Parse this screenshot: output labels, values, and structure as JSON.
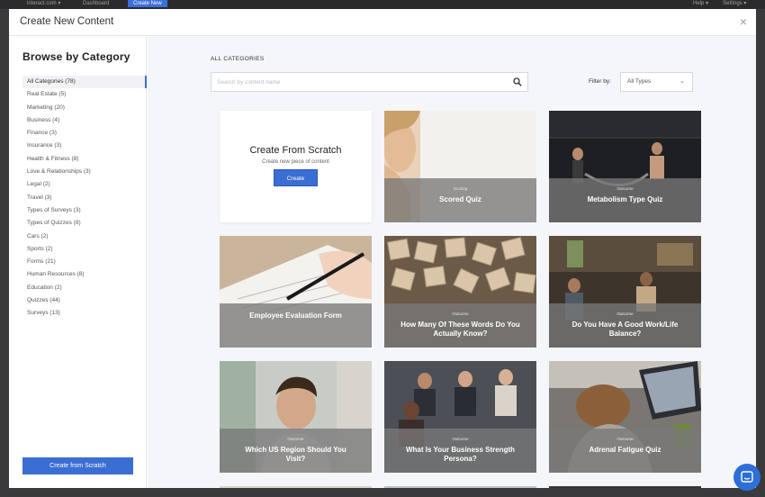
{
  "app_bar": {
    "items": [
      "interact.com ▾",
      "Dashboard",
      "Create New"
    ],
    "right_items": [
      "Help ▾",
      "Settings ▾"
    ]
  },
  "modal": {
    "title": "Create New Content",
    "close_label": "×"
  },
  "sidebar": {
    "title": "Browse by Category",
    "categories": [
      "All Categories (78)",
      "Real Estate (5)",
      "Marketing (20)",
      "Business (4)",
      "Finance (3)",
      "Insurance (3)",
      "Health & Fitness (8)",
      "Love & Relationships (3)",
      "Legal (2)",
      "Travel (3)",
      "Types of Surveys (3)",
      "Types of Quizzes (8)",
      "Cars (2)",
      "Sports (2)",
      "Forms (21)",
      "Human Resources (8)",
      "Education (2)",
      "Quizzes (44)",
      "Surveys (13)"
    ],
    "scratch_button": "Create from Scratch"
  },
  "main": {
    "section_label": "ALL CATEGORIES",
    "search_placeholder": "Search by content name",
    "filter_label": "Filter by:",
    "filter_value": "All Types",
    "scratch_card": {
      "title": "Create From Scratch",
      "subtitle": "Create new piece of content",
      "button": "Create"
    },
    "cards": [
      {
        "badge": "Scoring",
        "title": "Scored Quiz"
      },
      {
        "badge": "Outcome",
        "title": "Metabolism Type Quiz"
      },
      {
        "badge": "",
        "title": "Employee Evaluation Form"
      },
      {
        "badge": "Outcome",
        "title": "How Many Of These Words Do You Actually Know?"
      },
      {
        "badge": "Outcome",
        "title": "Do You Have A Good Work/Life Balance?"
      },
      {
        "badge": "Outcome",
        "title": "Which US Region Should You Visit?"
      },
      {
        "badge": "Outcome",
        "title": "What Is Your Business Strength Persona?"
      },
      {
        "badge": "Outcome",
        "title": "Adrenal Fatigue Quiz"
      }
    ]
  },
  "colors": {
    "accent": "#3a6ed3",
    "overlay": "#787878",
    "backdrop": "#3a3a3c",
    "main_bg": "#f4f6f9"
  },
  "icons": {
    "search": "search-icon",
    "close": "close-icon",
    "chevron": "chevron-down-icon",
    "chat": "chat-icon"
  }
}
